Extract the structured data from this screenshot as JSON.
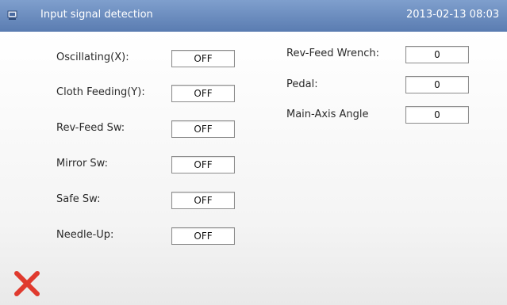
{
  "header": {
    "title": "Input signal detection",
    "datetime": "2013-02-13 08:03",
    "icon": "monitor-icon"
  },
  "left_signals": [
    {
      "label": "Oscillating(X):",
      "value": "OFF"
    },
    {
      "label": "Cloth Feeding(Y):",
      "value": "OFF"
    },
    {
      "label": "Rev-Feed Sw:",
      "value": "OFF"
    },
    {
      "label": "Mirror Sw:",
      "value": "OFF"
    },
    {
      "label": "Safe Sw:",
      "value": "OFF"
    },
    {
      "label": "Needle-Up:",
      "value": "OFF"
    }
  ],
  "right_signals": [
    {
      "label": "Rev-Feed Wrench:",
      "value": "0"
    },
    {
      "label": "Pedal:",
      "value": "0"
    },
    {
      "label": "Main-Axis Angle",
      "value": "0"
    }
  ],
  "footer": {
    "close_icon": "close-icon",
    "close_color": "#e03a2e"
  },
  "colors": {
    "titlebar": "#6a8cc0",
    "title_text": "#ffffff"
  }
}
